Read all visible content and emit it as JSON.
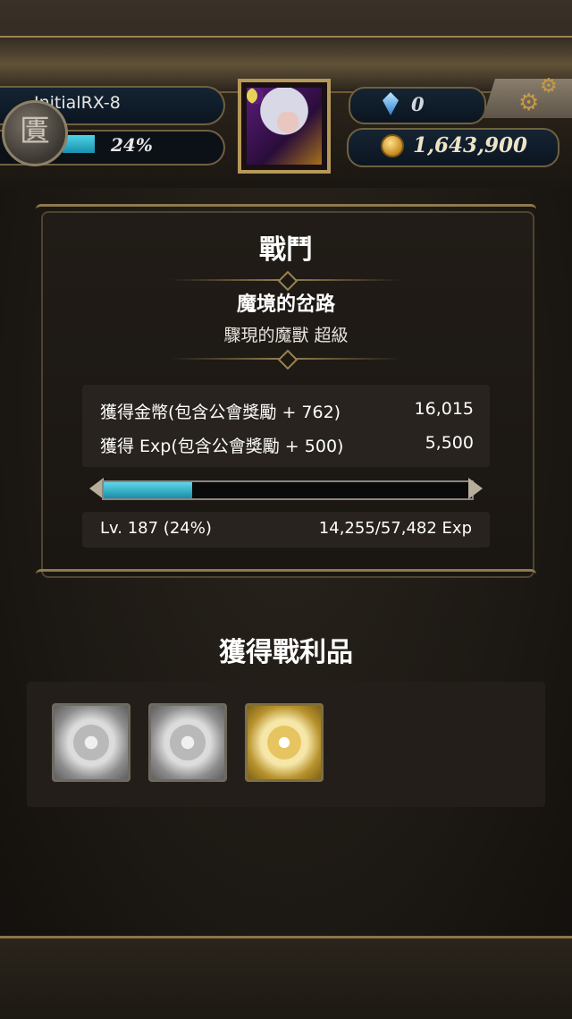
{
  "header": {
    "player_name": "InitialRX-8",
    "exp_percent_label": "24%",
    "exp_percent": 24,
    "rank_glyph": "匱",
    "gems": "0",
    "gold": "1,643,900"
  },
  "battle": {
    "title": "戰鬥",
    "stage_name": "魔境的岔路",
    "stage_subtitle": "驟現的魔獸 超級",
    "rewards": [
      {
        "label": "獲得金幣(包含公會獎勵 + 762)",
        "value": "16,015"
      },
      {
        "label": "獲得 Exp(包含公會獎勵 + 500)",
        "value": "5,500"
      }
    ],
    "level_label": "Lv. 187 (24%)",
    "level_progress": 0.24,
    "exp_label": "14,255/57,482 Exp"
  },
  "loot": {
    "title": "獲得戰利品",
    "items": [
      {
        "type": "silver-card"
      },
      {
        "type": "silver-card"
      },
      {
        "type": "gold-card"
      }
    ]
  },
  "colors": {
    "exp_fill": "#1a8da7",
    "ornament_gold": "#9a8152"
  }
}
